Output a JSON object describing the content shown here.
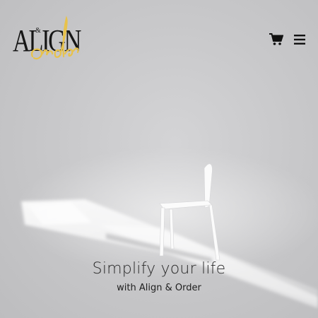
{
  "logo": {
    "wordmark": "ALIGN",
    "ampersand": "&",
    "script": "order",
    "accent_color": "#e8c24a"
  },
  "header": {
    "cart_icon": "shopping-cart-icon",
    "menu_icon": "hamburger-menu-icon"
  },
  "hero": {
    "image": "white-chair-shadow",
    "headline": "Simplify your life",
    "subheadline": "with Align & Order"
  },
  "colors": {
    "background": "#c9c9cb",
    "text": "#2a2a2a"
  }
}
